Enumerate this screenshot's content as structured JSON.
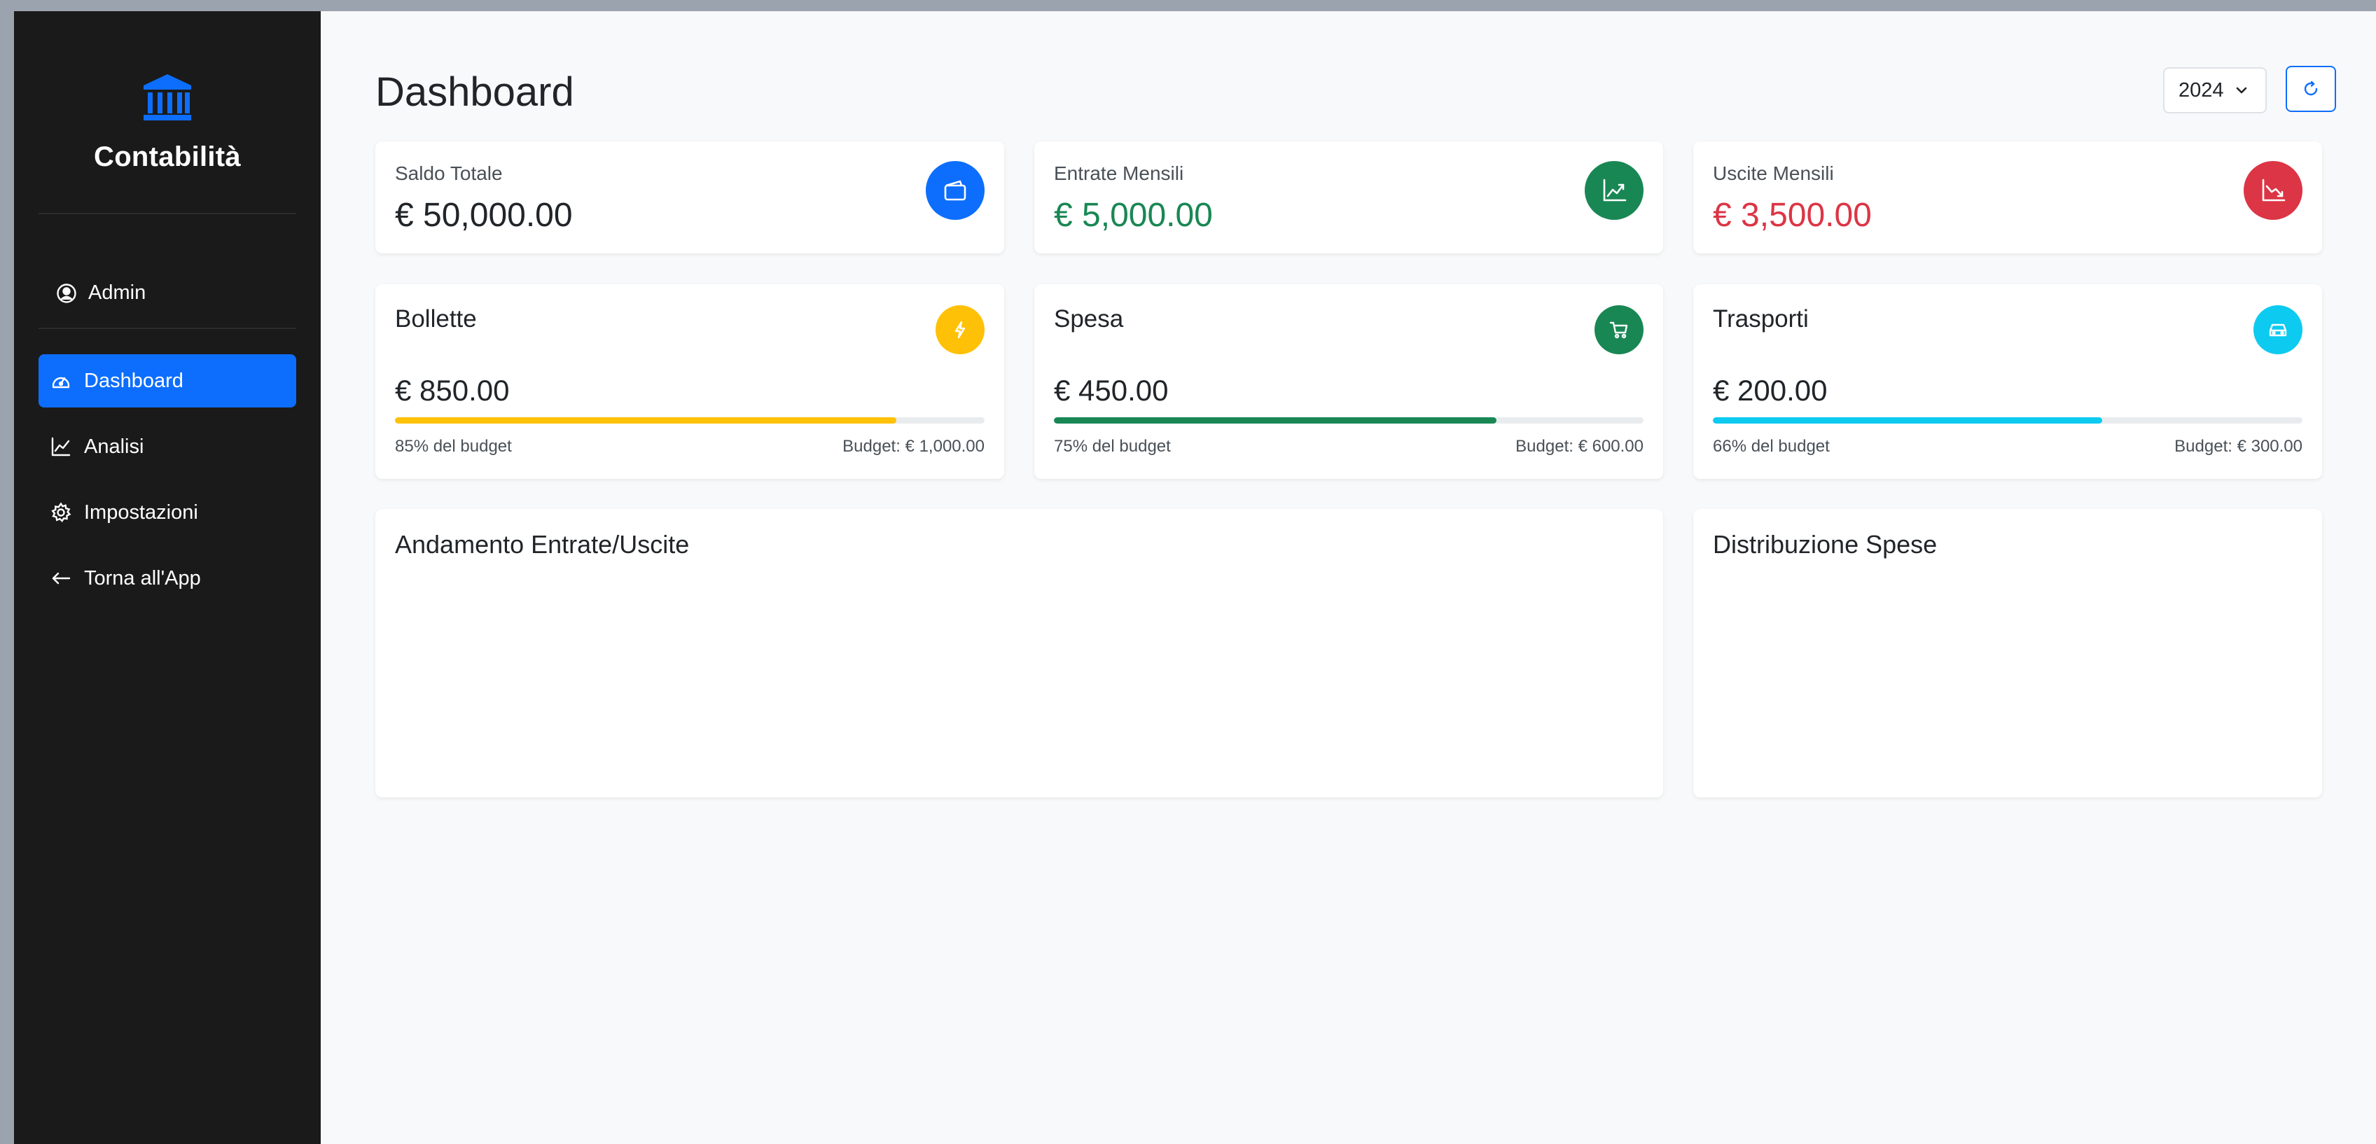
{
  "sidebar": {
    "brand": "Contabilità",
    "user": "Admin",
    "items": [
      {
        "label": "Dashboard",
        "icon": "speedometer-icon",
        "active": true
      },
      {
        "label": "Analisi",
        "icon": "line-chart-icon",
        "active": false
      },
      {
        "label": "Impostazioni",
        "icon": "gear-icon",
        "active": false
      },
      {
        "label": "Torna all'App",
        "icon": "arrow-left-icon",
        "active": false
      }
    ]
  },
  "header": {
    "title": "Dashboard",
    "year": "2024",
    "refresh_icon": "refresh-icon"
  },
  "stats": [
    {
      "label": "Saldo Totale",
      "value": "€ 50,000.00",
      "color": "#212529",
      "icon": "wallet-icon",
      "icon_bg": "#0d6efd"
    },
    {
      "label": "Entrate Mensili",
      "value": "€ 5,000.00",
      "color": "#198754",
      "icon": "trending-up-icon",
      "icon_bg": "#198754"
    },
    {
      "label": "Uscite Mensili",
      "value": "€ 3,500.00",
      "color": "#dc3545",
      "icon": "trending-down-icon",
      "icon_bg": "#dc3545"
    }
  ],
  "budgets": [
    {
      "title": "Bollette",
      "amount": "€ 850.00",
      "percent_label": "85% del budget",
      "budget_label": "Budget: € 1,000.00",
      "percent": 85,
      "color": "#ffc107",
      "icon": "lightning-icon"
    },
    {
      "title": "Spesa",
      "amount": "€ 450.00",
      "percent_label": "75% del budget",
      "budget_label": "Budget: € 600.00",
      "percent": 75,
      "color": "#198754",
      "icon": "cart-icon"
    },
    {
      "title": "Trasporti",
      "amount": "€ 200.00",
      "percent_label": "66% del budget",
      "budget_label": "Budget: € 300.00",
      "percent": 66,
      "color": "#0dcaf0",
      "icon": "car-icon"
    }
  ],
  "charts": [
    {
      "title": "Andamento Entrate/Uscite"
    },
    {
      "title": "Distribuzione Spese"
    }
  ]
}
